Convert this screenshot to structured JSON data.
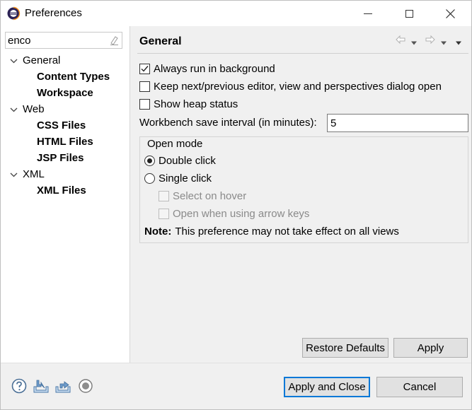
{
  "window": {
    "title": "Preferences",
    "title_icon": "eclipse-icon",
    "controls": [
      "minimize-icon",
      "maximize-icon",
      "close-icon"
    ]
  },
  "sidebar": {
    "filter": {
      "value": "enco",
      "placeholder": "",
      "clear_icon": "clear-filter-icon"
    },
    "tree": [
      {
        "label": "General",
        "expanded": true,
        "bold": false,
        "level": 0
      },
      {
        "label": "Content Types",
        "bold": true,
        "level": 1
      },
      {
        "label": "Workspace",
        "bold": true,
        "level": 1
      },
      {
        "label": "Web",
        "expanded": true,
        "bold": false,
        "level": 0
      },
      {
        "label": "CSS Files",
        "bold": true,
        "level": 1
      },
      {
        "label": "HTML Files",
        "bold": true,
        "level": 1
      },
      {
        "label": "JSP Files",
        "bold": true,
        "level": 1
      },
      {
        "label": "XML",
        "expanded": true,
        "bold": false,
        "level": 0
      },
      {
        "label": "XML Files",
        "bold": true,
        "level": 1
      }
    ]
  },
  "page": {
    "title": "General",
    "nav_icons": [
      "back-arrow-icon",
      "back-dropdown-icon",
      "forward-arrow-icon",
      "forward-dropdown-icon",
      "view-menu-icon"
    ],
    "options": {
      "always_run_background": {
        "label": "Always run in background",
        "checked": true
      },
      "keep_next_prev": {
        "label": "Keep next/previous editor, view and perspectives dialog open",
        "checked": false
      },
      "show_heap": {
        "label": "Show heap status",
        "checked": false
      }
    },
    "save_interval": {
      "label": "Workbench save interval (in minutes):",
      "value": "5"
    },
    "open_mode": {
      "title": "Open mode",
      "double_click": {
        "label": "Double click",
        "selected": true
      },
      "single_click": {
        "label": "Single click",
        "selected": false
      },
      "select_on_hover": {
        "label": "Select on hover",
        "enabled": false
      },
      "open_arrow_keys": {
        "label": "Open when using arrow keys",
        "enabled": false
      },
      "note_prefix": "Note:",
      "note_text": "This preference may not take effect on all views"
    },
    "restore_defaults_label": "Restore Defaults",
    "apply_label": "Apply"
  },
  "footer": {
    "icons": [
      "help-icon",
      "import-icon",
      "export-icon",
      "record-icon"
    ],
    "apply_close_label": "Apply and Close",
    "cancel_label": "Cancel"
  },
  "colors": {
    "accent": "#0078d7",
    "pane_bg": "#f0f0f0",
    "button_bg": "#e1e1e1"
  }
}
